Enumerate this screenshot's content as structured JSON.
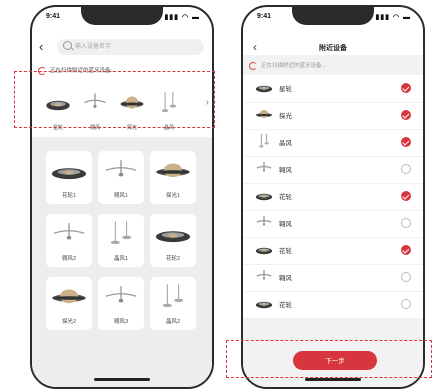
{
  "status": {
    "time": "9:41",
    "icons": "▮▮▮ ◠ ▬"
  },
  "left": {
    "back": "‹",
    "search_placeholder": "输入设备名字",
    "scan_text": "正在扫描附近的蓝牙设备...",
    "strip": [
      {
        "label": "星轮",
        "icon": "ring-lamp-icon"
      },
      {
        "label": "翱风",
        "icon": "ceiling-fan-icon"
      },
      {
        "label": "探光",
        "icon": "saucer-lamp-icon"
      },
      {
        "label": "晶风",
        "icon": "crystal-fan-icon"
      }
    ],
    "strip_arrow": "›",
    "grid": [
      {
        "label": "花轮1",
        "icon": "ring-lamp-icon"
      },
      {
        "label": "翱风1",
        "icon": "ceiling-fan-icon"
      },
      {
        "label": "探光1",
        "icon": "saucer-lamp-icon"
      },
      {
        "label": "翱风2",
        "icon": "ceiling-fan-icon"
      },
      {
        "label": "晶风1",
        "icon": "crystal-fan-icon"
      },
      {
        "label": "花轮2",
        "icon": "ring-lamp-icon"
      },
      {
        "label": "探光2",
        "icon": "saucer-lamp-icon"
      },
      {
        "label": "翱风3",
        "icon": "ceiling-fan-icon"
      },
      {
        "label": "晶风2",
        "icon": "crystal-fan-icon"
      }
    ]
  },
  "right": {
    "back": "‹",
    "title": "附近设备",
    "scan_text": "正在扫描附近的蓝牙设备...",
    "devices": [
      {
        "name": "星轮",
        "icon": "ring-lamp-icon",
        "checked": true
      },
      {
        "name": "探光",
        "icon": "saucer-lamp-icon",
        "checked": true
      },
      {
        "name": "晶风",
        "icon": "crystal-fan-icon",
        "checked": true
      },
      {
        "name": "翱风",
        "icon": "ceiling-fan-icon",
        "checked": false
      },
      {
        "name": "花轮",
        "icon": "ring-lamp-icon",
        "checked": true
      },
      {
        "name": "翱风",
        "icon": "ceiling-fan-icon",
        "checked": false
      },
      {
        "name": "花轮",
        "icon": "ring-lamp-icon",
        "checked": true
      },
      {
        "name": "翱风",
        "icon": "ceiling-fan-icon",
        "checked": false
      },
      {
        "name": "花轮",
        "icon": "ring-lamp-icon",
        "checked": false
      }
    ],
    "next_label": "下一步"
  },
  "colors": {
    "accent": "#d8363f",
    "gray_bg": "#ededed"
  }
}
